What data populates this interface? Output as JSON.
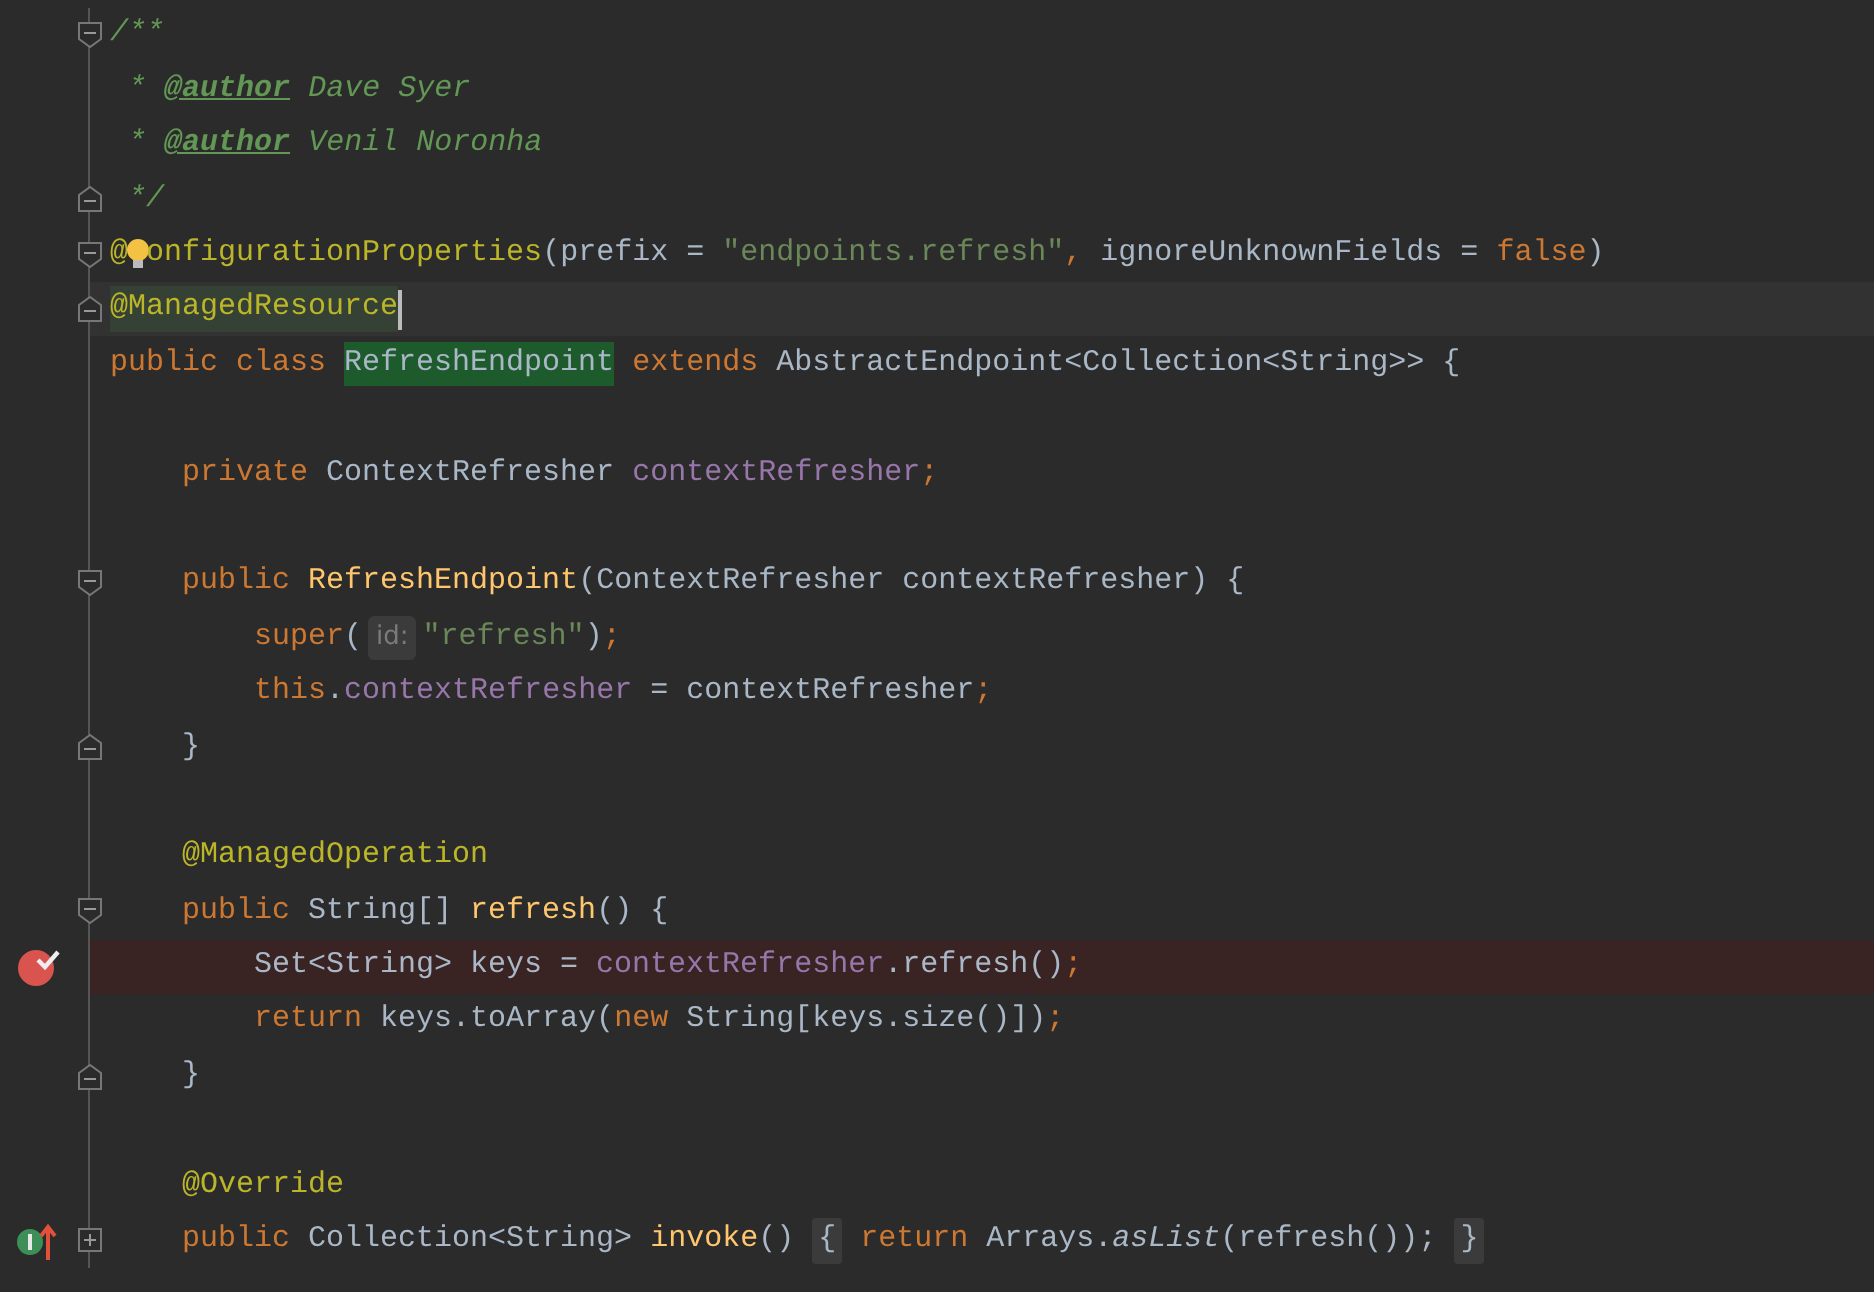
{
  "editor": {
    "lines": [
      {
        "gutter": [
          {
            "kind": "fold_start"
          }
        ],
        "current": false,
        "breakpoint": false,
        "tokens": [
          {
            "text": "/**",
            "kind": "doc"
          }
        ]
      },
      {
        "current": false,
        "breakpoint": false,
        "tokens": [
          {
            "text": " * ",
            "kind": "doc"
          },
          {
            "text": "@author",
            "kind": "doctag"
          },
          {
            "text": " Dave Syer",
            "kind": "doc"
          }
        ]
      },
      {
        "current": false,
        "breakpoint": false,
        "tokens": [
          {
            "text": " * ",
            "kind": "doc"
          },
          {
            "text": "@author",
            "kind": "doctag"
          },
          {
            "text": " Venil Noronha",
            "kind": "doc"
          }
        ]
      },
      {
        "gutter": [
          {
            "kind": "fold_end"
          }
        ],
        "current": false,
        "breakpoint": false,
        "tokens": [
          {
            "text": " */",
            "kind": "doc"
          }
        ]
      },
      {
        "gutter": [
          {
            "kind": "fold_start"
          }
        ],
        "current": false,
        "breakpoint": false,
        "tokens": [
          {
            "text": "@",
            "kind": "annotation"
          },
          {
            "kind": "bulb"
          },
          {
            "text": "onfigurationProperties",
            "kind": "annotation"
          },
          {
            "text": "(prefix = ",
            "kind": "plain"
          },
          {
            "text": "\"endpoints.refresh\"",
            "kind": "string"
          },
          {
            "text": ",",
            "kind": "keyword"
          },
          {
            "text": " ignoreUnknownFields = ",
            "kind": "plain"
          },
          {
            "text": "false",
            "kind": "keyword"
          },
          {
            "text": ")",
            "kind": "plain"
          }
        ]
      },
      {
        "gutter": [
          {
            "kind": "fold_end"
          }
        ],
        "current": true,
        "breakpoint": false,
        "tokens": [
          {
            "text": "@ManagedResource",
            "kind": "annotation_usage"
          }
        ]
      },
      {
        "current": false,
        "breakpoint": false,
        "tokens": [
          {
            "text": "public class ",
            "kind": "keyword"
          },
          {
            "text": "RefreshEndpoint",
            "kind": "highlight"
          },
          {
            "text": " extends ",
            "kind": "keyword"
          },
          {
            "text": "AbstractEndpoint<Collection<String>> {",
            "kind": "plain"
          }
        ]
      },
      {
        "current": false,
        "breakpoint": false
      },
      {
        "current": false,
        "breakpoint": false,
        "tokens": [
          {
            "text": "    private ",
            "kind": "keyword"
          },
          {
            "text": "ContextRefresher ",
            "kind": "plain"
          },
          {
            "text": "contextRefresher",
            "kind": "field"
          },
          {
            "text": ";",
            "kind": "keyword"
          }
        ]
      },
      {
        "current": false,
        "breakpoint": false
      },
      {
        "gutter": [
          {
            "kind": "fold_start"
          }
        ],
        "current": false,
        "breakpoint": false,
        "tokens": [
          {
            "text": "    public ",
            "kind": "keyword"
          },
          {
            "text": "RefreshEndpoint",
            "kind": "method"
          },
          {
            "text": "(ContextRefresher contextRefresher) {",
            "kind": "plain"
          }
        ]
      },
      {
        "current": false,
        "breakpoint": false,
        "tokens": [
          {
            "text": "        super",
            "kind": "keyword"
          },
          {
            "text": "(",
            "kind": "plain"
          },
          {
            "text": "id:",
            "kind": "hint"
          },
          {
            "text": "\"refresh\"",
            "kind": "string"
          },
          {
            "text": ")",
            "kind": "plain"
          },
          {
            "text": ";",
            "kind": "keyword"
          }
        ]
      },
      {
        "current": false,
        "breakpoint": false,
        "tokens": [
          {
            "text": "        this",
            "kind": "keyword"
          },
          {
            "text": ".",
            "kind": "plain"
          },
          {
            "text": "contextRefresher",
            "kind": "field"
          },
          {
            "text": " = contextRefresher",
            "kind": "plain"
          },
          {
            "text": ";",
            "kind": "keyword"
          }
        ]
      },
      {
        "gutter": [
          {
            "kind": "fold_end"
          }
        ],
        "current": false,
        "breakpoint": false,
        "tokens": [
          {
            "text": "    }",
            "kind": "plain"
          }
        ]
      },
      {
        "current": false,
        "breakpoint": false
      },
      {
        "current": false,
        "breakpoint": false,
        "tokens": [
          {
            "text": "    @ManagedOperation",
            "kind": "annotation"
          }
        ]
      },
      {
        "gutter": [
          {
            "kind": "fold_start"
          }
        ],
        "current": false,
        "breakpoint": false,
        "tokens": [
          {
            "text": "    public ",
            "kind": "keyword"
          },
          {
            "text": "String[] ",
            "kind": "plain"
          },
          {
            "text": "refresh",
            "kind": "method"
          },
          {
            "text": "() {",
            "kind": "plain"
          }
        ]
      },
      {
        "gutter": [
          {
            "kind": "breakpoint"
          }
        ],
        "current": false,
        "breakpoint": true,
        "tokens": [
          {
            "text": "        Set<String> keys = ",
            "kind": "plain"
          },
          {
            "text": "contextRefresher",
            "kind": "field"
          },
          {
            "text": ".refresh()",
            "kind": "plain"
          },
          {
            "text": ";",
            "kind": "keyword"
          }
        ]
      },
      {
        "current": false,
        "breakpoint": false,
        "tokens": [
          {
            "text": "        return ",
            "kind": "keyword"
          },
          {
            "text": "keys.toArray(",
            "kind": "plain"
          },
          {
            "text": "new ",
            "kind": "keyword"
          },
          {
            "text": "String[keys.size()])",
            "kind": "plain"
          },
          {
            "text": ";",
            "kind": "keyword"
          }
        ]
      },
      {
        "gutter": [
          {
            "kind": "fold_end"
          }
        ],
        "current": false,
        "breakpoint": false,
        "tokens": [
          {
            "text": "    }",
            "kind": "plain"
          }
        ]
      },
      {
        "current": false,
        "breakpoint": false
      },
      {
        "current": false,
        "breakpoint": false,
        "tokens": [
          {
            "text": "    @Override",
            "kind": "annotation"
          }
        ]
      },
      {
        "gutter": [
          {
            "kind": "implements"
          },
          {
            "kind": "fold_collapsed"
          }
        ],
        "current": false,
        "breakpoint": false,
        "tokens": [
          {
            "text": "    public ",
            "kind": "keyword"
          },
          {
            "text": "Collection<String> ",
            "kind": "plain"
          },
          {
            "text": "invoke",
            "kind": "method"
          },
          {
            "text": "() ",
            "kind": "plain"
          },
          {
            "text": "{",
            "kind": "fold_brace"
          },
          {
            "text": " return ",
            "kind": "keyword"
          },
          {
            "text": "Arrays.",
            "kind": "plain"
          },
          {
            "text": "asList",
            "kind": "static_call"
          },
          {
            "text": "(refresh()); ",
            "kind": "plain"
          },
          {
            "text": "}",
            "kind": "fold_brace"
          }
        ]
      }
    ]
  }
}
